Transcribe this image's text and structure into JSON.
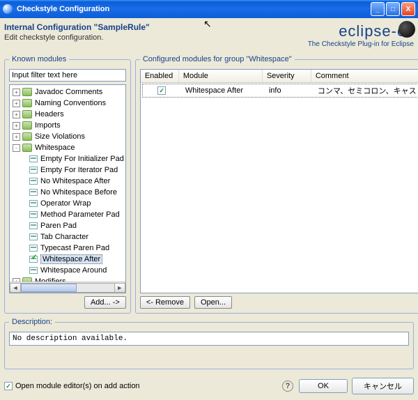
{
  "window": {
    "title": "Checkstyle Configuration"
  },
  "header": {
    "config_name": "Internal Configuration \"SampleRule\"",
    "subtitle": "Edit checkstyle configuration.",
    "brand": "eclipse-cs",
    "brand_sub": "The Checkstyle Plug-in for Eclipse"
  },
  "known": {
    "legend": "Known modules",
    "filter_placeholder": "Input filter text here",
    "add_button": "Add... ->",
    "groups": [
      {
        "label": "Javadoc Comments",
        "expanded": false
      },
      {
        "label": "Naming Conventions",
        "expanded": false
      },
      {
        "label": "Headers",
        "expanded": false
      },
      {
        "label": "Imports",
        "expanded": false
      },
      {
        "label": "Size Violations",
        "expanded": false
      },
      {
        "label": "Whitespace",
        "expanded": true,
        "children": [
          {
            "label": "Empty For Initializer Pad"
          },
          {
            "label": "Empty For Iterator Pad"
          },
          {
            "label": "No Whitespace After"
          },
          {
            "label": "No Whitespace Before"
          },
          {
            "label": "Operator Wrap"
          },
          {
            "label": "Method Parameter Pad"
          },
          {
            "label": "Paren Pad"
          },
          {
            "label": "Tab Character"
          },
          {
            "label": "Typecast Paren Pad"
          },
          {
            "label": "Whitespace After",
            "selected": true,
            "checked": true
          },
          {
            "label": "Whitespace Around"
          }
        ]
      },
      {
        "label": "Modifiers",
        "expanded": false
      }
    ]
  },
  "configured": {
    "legend": "Configured modules for group \"Whitespace\"",
    "columns": {
      "enabled": "Enabled",
      "module": "Module",
      "severity": "Severity",
      "comment": "Comment"
    },
    "rows": [
      {
        "enabled": true,
        "module": "Whitespace After",
        "severity": "info",
        "comment": "コンマ、セミコロン、キャストの後..."
      }
    ],
    "remove_button": "<- Remove",
    "open_button": "Open..."
  },
  "description": {
    "legend": "Description:",
    "text": "No description available."
  },
  "footer": {
    "checkbox_label": "Open module editor(s) on add action",
    "ok": "OK",
    "cancel": "キャンセル"
  }
}
